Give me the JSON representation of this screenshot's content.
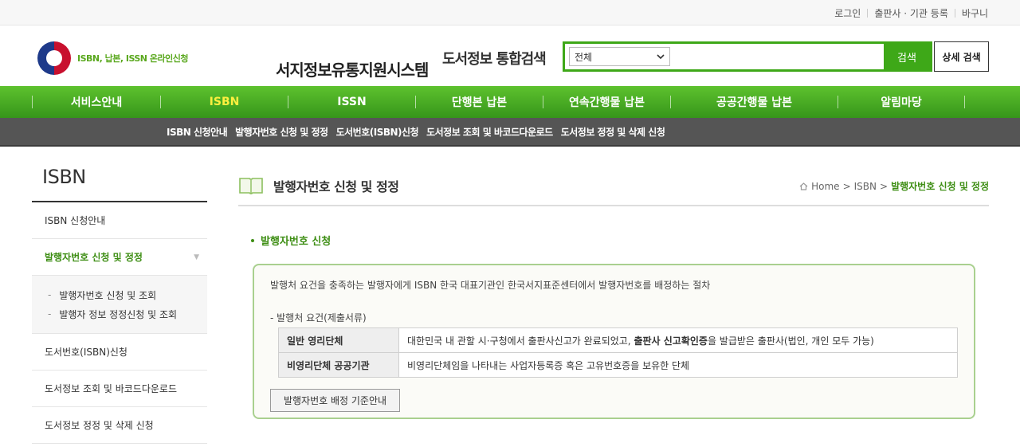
{
  "util": {
    "login": "로그인",
    "register": "출판사 · 기관 등록",
    "cart": "바구니"
  },
  "logo": {
    "sub": "ISBN, 납본, ISSN 온라인신청",
    "main": "서지정보유통지원시스템"
  },
  "search": {
    "title": "도서정보 통합검색",
    "select_value": "전체",
    "button": "검색",
    "detail": "상세 검색"
  },
  "gnb": [
    "서비스안내",
    "ISBN",
    "ISSN",
    "단행본 납본",
    "연속간행물 납본",
    "공공간행물 납본",
    "알림마당"
  ],
  "snb": [
    "ISBN 신청안내",
    "발행자번호 신청 및 정정",
    "도서번호(ISBN)신청",
    "도서정보 조회 및 바코드다운로드",
    "도서정보 정정 및 삭제 신청"
  ],
  "side": {
    "title": "ISBN",
    "items": [
      "ISBN 신청안내",
      "발행자번호 신청 및 정정",
      "도서번호(ISBN)신청",
      "도서정보 조회 및 바코드다운로드",
      "도서정보 정정 및 삭제 신청"
    ],
    "sub": [
      "발행자번호 신청 및 조회",
      "발행자 정보 정정신청 및 조회"
    ]
  },
  "page": {
    "title": "발행자번호 신청 및 정정",
    "breadcrumb": {
      "home": "Home",
      "sep1": ">",
      "mid": "ISBN",
      "sep2": ">",
      "current": "발행자번호 신청 및 정정"
    },
    "section_title": "발행자번호 신청",
    "description": "발행처 요건을 충족하는 발행자에게 ISBN 한국 대표기관인 한국서지표준센터에서 발행자번호를 배정하는 절차",
    "req_title": "- 발행처 요건(제출서류)",
    "table": [
      {
        "head": "일반 영리단체",
        "pre": "대한민국 내 관할 시·구청에서 출판사신고가 완료되었고, ",
        "bold": "출판사 신고확인증",
        "post": "을 발급받은 출판사(법인, 개인 모두 가능)"
      },
      {
        "head": "비영리단체 공공기관",
        "pre": "비영리단체임을 나타내는 사업자등록증 혹은 고유번호증을 보유한 단체",
        "bold": "",
        "post": ""
      }
    ],
    "guide_button": "발행자번호 배정 기준안내"
  },
  "colors": {
    "green": "#3ea818",
    "green_text": "#3e8e14",
    "active_menu": "#ffef3f",
    "snb_bg": "#555555"
  }
}
